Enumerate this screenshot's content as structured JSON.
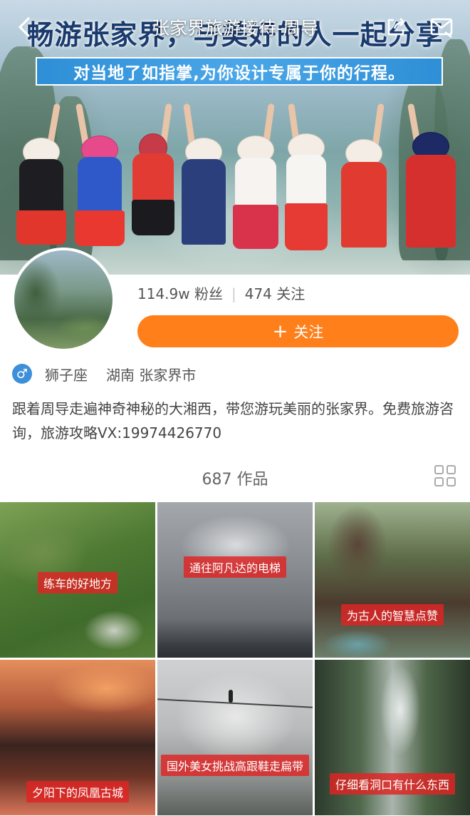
{
  "header": {
    "title": "张家界旅游接待-周导",
    "back_icon": "chevron-left-icon",
    "share_icon": "share-icon",
    "message_icon": "mail-icon"
  },
  "banner": {
    "headline": "畅游张家界，与美好的人一起分享",
    "subline": "对当地了如指掌,为你设计专属于你的行程。"
  },
  "profile": {
    "followers": "114.9w 粉丝",
    "following": "474 关注",
    "follow_button": "关注",
    "gender_icon": "male-icon",
    "zodiac": "狮子座",
    "location": "湖南 张家界市",
    "bio": "跟着周导走遍神奇神秘的大湘西，带您游玩美丽的张家界。免费旅游咨询，旅游攻略VX:19974426770"
  },
  "works": {
    "title": "687 作品",
    "items": [
      {
        "caption": "练车的好地方"
      },
      {
        "caption": "通往阿凡达的电梯"
      },
      {
        "caption": "为古人的智慧点赞"
      },
      {
        "caption": "夕阳下的凤凰古城"
      },
      {
        "caption": "国外美女挑战高跟鞋走扁带"
      },
      {
        "caption": "仔细看洞口有什么东西"
      }
    ]
  },
  "colors": {
    "accent": "#ff7f1a",
    "gender": "#3d8fd9",
    "caption_bg": "#e12323"
  }
}
